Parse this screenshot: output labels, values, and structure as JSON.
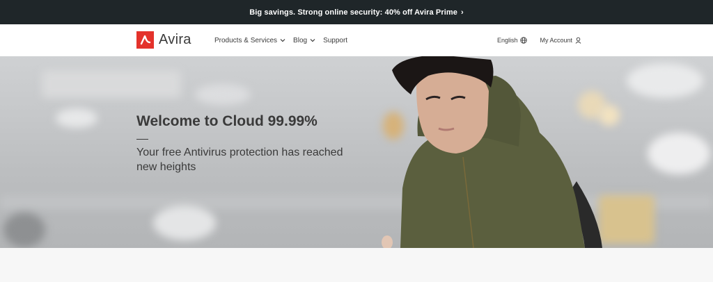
{
  "promo": {
    "text": "Big savings. Strong online security: 40% off Avira Prime",
    "chevron": "›"
  },
  "nav": {
    "brand": "Avira",
    "links": [
      {
        "label": "Products & Services",
        "has_dropdown": true
      },
      {
        "label": "Blog",
        "has_dropdown": true
      },
      {
        "label": "Support",
        "has_dropdown": false
      }
    ],
    "language": "English",
    "account": "My Account"
  },
  "hero": {
    "title": "Welcome to Cloud 99.99%",
    "subtitle": "Your free Antivirus protection has reached new heights"
  },
  "colors": {
    "promo_bg": "#1f2629",
    "brand_red": "#e4322b",
    "jacket": "#5b5f3e"
  }
}
